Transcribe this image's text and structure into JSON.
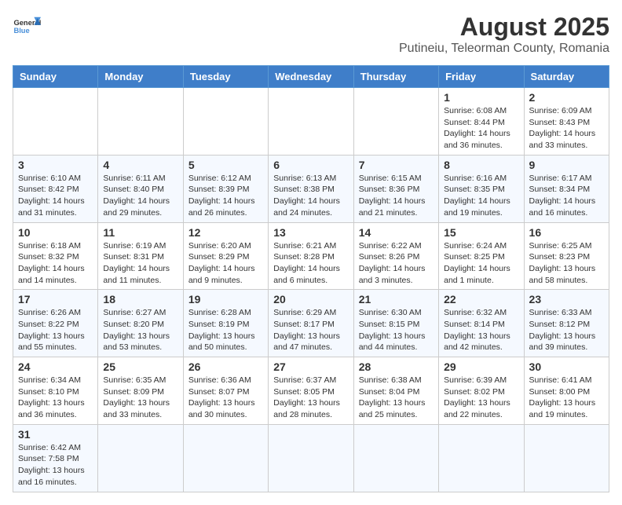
{
  "header": {
    "logo_general": "General",
    "logo_blue": "Blue",
    "title": "August 2025",
    "subtitle": "Putineiu, Teleorman County, Romania"
  },
  "days_of_week": [
    "Sunday",
    "Monday",
    "Tuesday",
    "Wednesday",
    "Thursday",
    "Friday",
    "Saturday"
  ],
  "weeks": [
    [
      {
        "day": "",
        "info": ""
      },
      {
        "day": "",
        "info": ""
      },
      {
        "day": "",
        "info": ""
      },
      {
        "day": "",
        "info": ""
      },
      {
        "day": "",
        "info": ""
      },
      {
        "day": "1",
        "info": "Sunrise: 6:08 AM\nSunset: 8:44 PM\nDaylight: 14 hours and 36 minutes."
      },
      {
        "day": "2",
        "info": "Sunrise: 6:09 AM\nSunset: 8:43 PM\nDaylight: 14 hours and 33 minutes."
      }
    ],
    [
      {
        "day": "3",
        "info": "Sunrise: 6:10 AM\nSunset: 8:42 PM\nDaylight: 14 hours and 31 minutes."
      },
      {
        "day": "4",
        "info": "Sunrise: 6:11 AM\nSunset: 8:40 PM\nDaylight: 14 hours and 29 minutes."
      },
      {
        "day": "5",
        "info": "Sunrise: 6:12 AM\nSunset: 8:39 PM\nDaylight: 14 hours and 26 minutes."
      },
      {
        "day": "6",
        "info": "Sunrise: 6:13 AM\nSunset: 8:38 PM\nDaylight: 14 hours and 24 minutes."
      },
      {
        "day": "7",
        "info": "Sunrise: 6:15 AM\nSunset: 8:36 PM\nDaylight: 14 hours and 21 minutes."
      },
      {
        "day": "8",
        "info": "Sunrise: 6:16 AM\nSunset: 8:35 PM\nDaylight: 14 hours and 19 minutes."
      },
      {
        "day": "9",
        "info": "Sunrise: 6:17 AM\nSunset: 8:34 PM\nDaylight: 14 hours and 16 minutes."
      }
    ],
    [
      {
        "day": "10",
        "info": "Sunrise: 6:18 AM\nSunset: 8:32 PM\nDaylight: 14 hours and 14 minutes."
      },
      {
        "day": "11",
        "info": "Sunrise: 6:19 AM\nSunset: 8:31 PM\nDaylight: 14 hours and 11 minutes."
      },
      {
        "day": "12",
        "info": "Sunrise: 6:20 AM\nSunset: 8:29 PM\nDaylight: 14 hours and 9 minutes."
      },
      {
        "day": "13",
        "info": "Sunrise: 6:21 AM\nSunset: 8:28 PM\nDaylight: 14 hours and 6 minutes."
      },
      {
        "day": "14",
        "info": "Sunrise: 6:22 AM\nSunset: 8:26 PM\nDaylight: 14 hours and 3 minutes."
      },
      {
        "day": "15",
        "info": "Sunrise: 6:24 AM\nSunset: 8:25 PM\nDaylight: 14 hours and 1 minute."
      },
      {
        "day": "16",
        "info": "Sunrise: 6:25 AM\nSunset: 8:23 PM\nDaylight: 13 hours and 58 minutes."
      }
    ],
    [
      {
        "day": "17",
        "info": "Sunrise: 6:26 AM\nSunset: 8:22 PM\nDaylight: 13 hours and 55 minutes."
      },
      {
        "day": "18",
        "info": "Sunrise: 6:27 AM\nSunset: 8:20 PM\nDaylight: 13 hours and 53 minutes."
      },
      {
        "day": "19",
        "info": "Sunrise: 6:28 AM\nSunset: 8:19 PM\nDaylight: 13 hours and 50 minutes."
      },
      {
        "day": "20",
        "info": "Sunrise: 6:29 AM\nSunset: 8:17 PM\nDaylight: 13 hours and 47 minutes."
      },
      {
        "day": "21",
        "info": "Sunrise: 6:30 AM\nSunset: 8:15 PM\nDaylight: 13 hours and 44 minutes."
      },
      {
        "day": "22",
        "info": "Sunrise: 6:32 AM\nSunset: 8:14 PM\nDaylight: 13 hours and 42 minutes."
      },
      {
        "day": "23",
        "info": "Sunrise: 6:33 AM\nSunset: 8:12 PM\nDaylight: 13 hours and 39 minutes."
      }
    ],
    [
      {
        "day": "24",
        "info": "Sunrise: 6:34 AM\nSunset: 8:10 PM\nDaylight: 13 hours and 36 minutes."
      },
      {
        "day": "25",
        "info": "Sunrise: 6:35 AM\nSunset: 8:09 PM\nDaylight: 13 hours and 33 minutes."
      },
      {
        "day": "26",
        "info": "Sunrise: 6:36 AM\nSunset: 8:07 PM\nDaylight: 13 hours and 30 minutes."
      },
      {
        "day": "27",
        "info": "Sunrise: 6:37 AM\nSunset: 8:05 PM\nDaylight: 13 hours and 28 minutes."
      },
      {
        "day": "28",
        "info": "Sunrise: 6:38 AM\nSunset: 8:04 PM\nDaylight: 13 hours and 25 minutes."
      },
      {
        "day": "29",
        "info": "Sunrise: 6:39 AM\nSunset: 8:02 PM\nDaylight: 13 hours and 22 minutes."
      },
      {
        "day": "30",
        "info": "Sunrise: 6:41 AM\nSunset: 8:00 PM\nDaylight: 13 hours and 19 minutes."
      }
    ],
    [
      {
        "day": "31",
        "info": "Sunrise: 6:42 AM\nSunset: 7:58 PM\nDaylight: 13 hours and 16 minutes."
      },
      {
        "day": "",
        "info": ""
      },
      {
        "day": "",
        "info": ""
      },
      {
        "day": "",
        "info": ""
      },
      {
        "day": "",
        "info": ""
      },
      {
        "day": "",
        "info": ""
      },
      {
        "day": "",
        "info": ""
      }
    ]
  ]
}
